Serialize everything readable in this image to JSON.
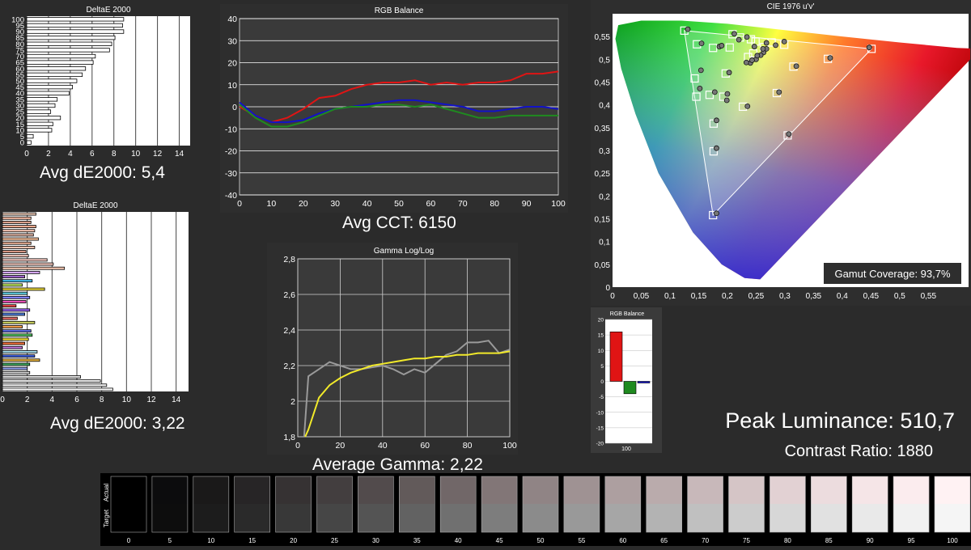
{
  "chart_data": [
    {
      "id": "grayscale_de",
      "type": "bar",
      "orientation": "horizontal",
      "title": "DeltaE 2000",
      "categories": [
        "0",
        "5",
        "10",
        "15",
        "20",
        "25",
        "30",
        "35",
        "40",
        "45",
        "50",
        "55",
        "60",
        "65",
        "70",
        "75",
        "80",
        "85",
        "90",
        "95",
        "100"
      ],
      "tick_labels_y": [
        "100",
        "95",
        "90",
        "85",
        "80",
        "75",
        "70",
        "65",
        "60",
        "55",
        "50",
        "45",
        "40",
        "35",
        "30",
        "25",
        "20",
        "15",
        "10",
        "5",
        "0"
      ],
      "values": [
        0.4,
        0.6,
        2.3,
        2.4,
        3.1,
        2.2,
        2.6,
        2.8,
        3.9,
        4.2,
        4.6,
        5.1,
        5.4,
        6.1,
        6.3,
        7.6,
        7.8,
        8.1,
        8.9,
        8.8,
        8.9
      ],
      "xlim": [
        0,
        15
      ],
      "xticks": [
        0,
        2,
        4,
        6,
        8,
        10,
        12,
        14
      ],
      "grid": true,
      "summary": "Avg dE2000: 5,4"
    },
    {
      "id": "colorchecker_de",
      "type": "bar",
      "orientation": "horizontal",
      "title": "DeltaE 2000",
      "values": [
        2.7,
        2.3,
        2.3,
        2.7,
        2.6,
        2.5,
        2.9,
        2.3,
        2.6,
        1.9,
        2.1,
        3.6,
        4.1,
        5.0,
        3.0,
        1.8,
        2.4,
        1.6,
        3.4,
        2.0,
        2.2,
        1.9,
        1.1,
        2.2,
        1.8,
        1.2,
        2.6,
        1.6,
        2.3,
        2.4,
        2.1,
        1.8,
        1.6,
        2.8,
        2.6,
        3.0,
        2.2,
        2.0,
        2.2,
        6.3,
        7.9,
        8.4,
        8.9
      ],
      "bar_colors": [
        "#e7c6b3",
        "#f3b9a1",
        "#d99f8a",
        "#e9a78c",
        "#f4c4b2",
        "#ddb0a0",
        "#f7c09a",
        "#e6ad93",
        "#ecc2ae",
        "#d49481",
        "#f0c2b6",
        "#f6c8c1",
        "#f2c5ba",
        "#f7c9b2",
        "#d7a8f6",
        "#9c62c9",
        "#46b9e8",
        "#bbe65c",
        "#e5d438",
        "#5fd0e3",
        "#7e7ef5",
        "#e94fb6",
        "#e34646",
        "#9660ef",
        "#4b7ad6",
        "#e06a66",
        "#c9d05d",
        "#ee9b4b",
        "#5b6be0",
        "#4fbf60",
        "#f2e036",
        "#eb6c38",
        "#b86ecf",
        "#9fd4e4",
        "#3f5fd6",
        "#e3b03f",
        "#3ea35a",
        "#8a9be5",
        "#c9c9c9",
        "#dedede",
        "#efefef",
        "#f7f7f7",
        "#ffffff"
      ],
      "xlim": [
        0,
        15
      ],
      "xticks": [
        0,
        2,
        4,
        6,
        8,
        10,
        12,
        14
      ],
      "grid": true,
      "summary": "Avg dE2000: 3,22"
    },
    {
      "id": "rgb_balance",
      "type": "line",
      "title": "RGB Balance",
      "x": [
        0,
        5,
        10,
        15,
        20,
        25,
        30,
        35,
        40,
        45,
        50,
        55,
        60,
        65,
        70,
        75,
        80,
        85,
        90,
        95,
        100
      ],
      "series": [
        {
          "name": "",
          "color": "#e01414",
          "values": [
            0,
            -4,
            -7,
            -5,
            -1,
            4,
            5,
            8,
            10,
            11,
            11,
            12,
            10,
            11,
            10,
            11,
            11,
            12,
            15,
            15,
            16
          ]
        },
        {
          "name": "",
          "color": "#1212c8",
          "values": [
            2,
            -4,
            -7,
            -7,
            -6,
            -3,
            -1,
            0,
            1,
            2,
            3,
            3,
            2,
            1,
            0,
            -2,
            -2,
            -1,
            0,
            0,
            -1
          ]
        },
        {
          "name": "",
          "color": "#1f8a1f",
          "values": [
            1,
            -5,
            -9,
            -9,
            -7,
            -4,
            -1,
            0,
            0,
            1,
            1,
            0,
            1,
            -1,
            -3,
            -5,
            -5,
            -4,
            -4,
            -4,
            -4
          ]
        }
      ],
      "xlim": [
        0,
        100
      ],
      "ylim": [
        -40,
        40
      ],
      "xticks": [
        0,
        10,
        20,
        30,
        40,
        50,
        60,
        70,
        80,
        90,
        100
      ],
      "yticks": [
        40,
        30,
        20,
        10,
        0,
        -10,
        -20,
        -30,
        -40
      ],
      "grid": true,
      "summary": "Avg CCT: 6150"
    },
    {
      "id": "gamma",
      "type": "line",
      "title": "Gamma Log/Log",
      "x": [
        5,
        10,
        15,
        20,
        25,
        30,
        35,
        40,
        45,
        50,
        55,
        60,
        65,
        70,
        75,
        80,
        85,
        90,
        95,
        100
      ],
      "series": [
        {
          "name": "",
          "color": "#9a9a9a",
          "values": [
            2.14,
            2.18,
            2.22,
            2.2,
            2.18,
            2.18,
            2.19,
            2.2,
            2.18,
            2.15,
            2.18,
            2.16,
            2.21,
            2.26,
            2.28,
            2.33,
            2.33,
            2.34,
            2.27,
            2.29
          ]
        },
        {
          "name": "",
          "color": "#f2ea2a",
          "values": [
            1.84,
            2.02,
            2.09,
            2.13,
            2.16,
            2.18,
            2.2,
            2.21,
            2.22,
            2.23,
            2.24,
            2.24,
            2.25,
            2.25,
            2.26,
            2.26,
            2.27,
            2.27,
            2.27,
            2.28
          ]
        }
      ],
      "xlim": [
        0,
        100
      ],
      "ylim": [
        1.8,
        2.8
      ],
      "xticks": [
        0,
        20,
        40,
        60,
        80,
        100
      ],
      "yticks": [
        "2,8",
        "2,6",
        "2,4",
        "2,2",
        "2",
        "1,8"
      ],
      "grid": true,
      "summary": "Average Gamma: 2,22"
    },
    {
      "id": "cie",
      "type": "scatter",
      "title": "CIE 1976 u'v'",
      "xlim": [
        0,
        0.62
      ],
      "ylim": [
        0,
        0.6
      ],
      "xticks": [
        "0",
        "0,05",
        "0,1",
        "0,15",
        "0,2",
        "0,25",
        "0,3",
        "0,35",
        "0,4",
        "0,45",
        "0,5",
        "0,55"
      ],
      "yticks": [
        "0,55",
        "0,5",
        "0,45",
        "0,4",
        "0,35",
        "0,3",
        "0,25",
        "0,2",
        "0,15",
        "0,1",
        "0,05",
        "0"
      ],
      "gamut_triangle": [
        [
          0.451,
          0.523
        ],
        [
          0.125,
          0.563
        ],
        [
          0.175,
          0.158
        ]
      ],
      "targets": [
        [
          0.451,
          0.523
        ],
        [
          0.125,
          0.563
        ],
        [
          0.175,
          0.158
        ],
        [
          0.197,
          0.469
        ],
        [
          0.147,
          0.533
        ],
        [
          0.175,
          0.525
        ],
        [
          0.143,
          0.458
        ],
        [
          0.146,
          0.418
        ],
        [
          0.176,
          0.359
        ],
        [
          0.176,
          0.298
        ],
        [
          0.169,
          0.422
        ],
        [
          0.193,
          0.418
        ],
        [
          0.227,
          0.396
        ],
        [
          0.286,
          0.426
        ],
        [
          0.305,
          0.333
        ],
        [
          0.375,
          0.501
        ],
        [
          0.315,
          0.484
        ],
        [
          0.209,
          0.555
        ],
        [
          0.222,
          0.548
        ],
        [
          0.204,
          0.526
        ],
        [
          0.241,
          0.544
        ],
        [
          0.249,
          0.539
        ],
        [
          0.277,
          0.537
        ],
        [
          0.299,
          0.532
        ],
        [
          0.264,
          0.527
        ],
        [
          0.245,
          0.513
        ],
        [
          0.236,
          0.505
        ]
      ],
      "measured": [
        [
          0.447,
          0.526
        ],
        [
          0.131,
          0.566
        ],
        [
          0.181,
          0.162
        ],
        [
          0.203,
          0.471
        ],
        [
          0.155,
          0.535
        ],
        [
          0.186,
          0.528
        ],
        [
          0.154,
          0.476
        ],
        [
          0.152,
          0.436
        ],
        [
          0.181,
          0.366
        ],
        [
          0.181,
          0.305
        ],
        [
          0.178,
          0.428
        ],
        [
          0.2,
          0.424
        ],
        [
          0.235,
          0.397
        ],
        [
          0.29,
          0.428
        ],
        [
          0.307,
          0.336
        ],
        [
          0.379,
          0.503
        ],
        [
          0.32,
          0.485
        ],
        [
          0.212,
          0.556
        ],
        [
          0.22,
          0.543
        ],
        [
          0.19,
          0.53
        ],
        [
          0.234,
          0.549
        ],
        [
          0.247,
          0.528
        ],
        [
          0.268,
          0.523
        ],
        [
          0.263,
          0.515
        ],
        [
          0.258,
          0.509
        ],
        [
          0.25,
          0.5
        ],
        [
          0.24,
          0.492
        ],
        [
          0.252,
          0.508
        ],
        [
          0.243,
          0.498
        ],
        [
          0.233,
          0.493
        ],
        [
          0.262,
          0.523
        ],
        [
          0.284,
          0.531
        ],
        [
          0.299,
          0.539
        ],
        [
          0.268,
          0.536
        ],
        [
          0.199,
          0.41
        ]
      ],
      "summary": "Gamut Coverage: 93,7%"
    },
    {
      "id": "rgb_balance_small",
      "type": "bar",
      "title": "RGB Balance",
      "categories": [
        "100"
      ],
      "series": [
        {
          "name": "",
          "color": "#e01414",
          "values": [
            16
          ]
        },
        {
          "name": "",
          "color": "#1f8a1f",
          "values": [
            -4
          ]
        },
        {
          "name": "",
          "color": "#1212c8",
          "values": [
            -0.4
          ]
        }
      ],
      "ylim": [
        -20,
        20
      ],
      "yticks": [
        "20",
        "15",
        "10",
        "5",
        "0",
        "-5",
        "-10",
        "-15",
        "-20"
      ],
      "grid": true
    },
    {
      "id": "grayscale_swatches",
      "type": "table",
      "row_labels": [
        "Actual",
        "Target"
      ],
      "categories": [
        "0",
        "5",
        "10",
        "15",
        "20",
        "25",
        "30",
        "35",
        "40",
        "45",
        "50",
        "55",
        "60",
        "65",
        "70",
        "75",
        "80",
        "85",
        "90",
        "95",
        "100"
      ],
      "actual": [
        "#000000",
        "#0c0c0d",
        "#1a1919",
        "#272526",
        "#363233",
        "#433e3f",
        "#524b4c",
        "#625a5a",
        "#716768",
        "#827677",
        "#908485",
        "#9f9293",
        "#ad9fa0",
        "#baabac",
        "#c8b8ba",
        "#d5c5c6",
        "#e2d1d3",
        "#ecdcde",
        "#f5e5e7",
        "#fbecee",
        "#fff2f3"
      ],
      "target": [
        "#000000",
        "#0d0d0d",
        "#1c1c1c",
        "#2a2a2a",
        "#383838",
        "#464646",
        "#545454",
        "#626262",
        "#707070",
        "#7d7d7d",
        "#8b8b8b",
        "#999999",
        "#a6a6a6",
        "#b3b3b3",
        "#c0c0c0",
        "#cccccc",
        "#d7d7d7",
        "#e1e1e1",
        "#e9e9e9",
        "#f1f1f1",
        "#f5f5f5"
      ]
    }
  ],
  "headline": {
    "peak_luminance": "Peak Luminance: 510,7",
    "contrast_ratio": "Contrast Ratio: 1880"
  }
}
